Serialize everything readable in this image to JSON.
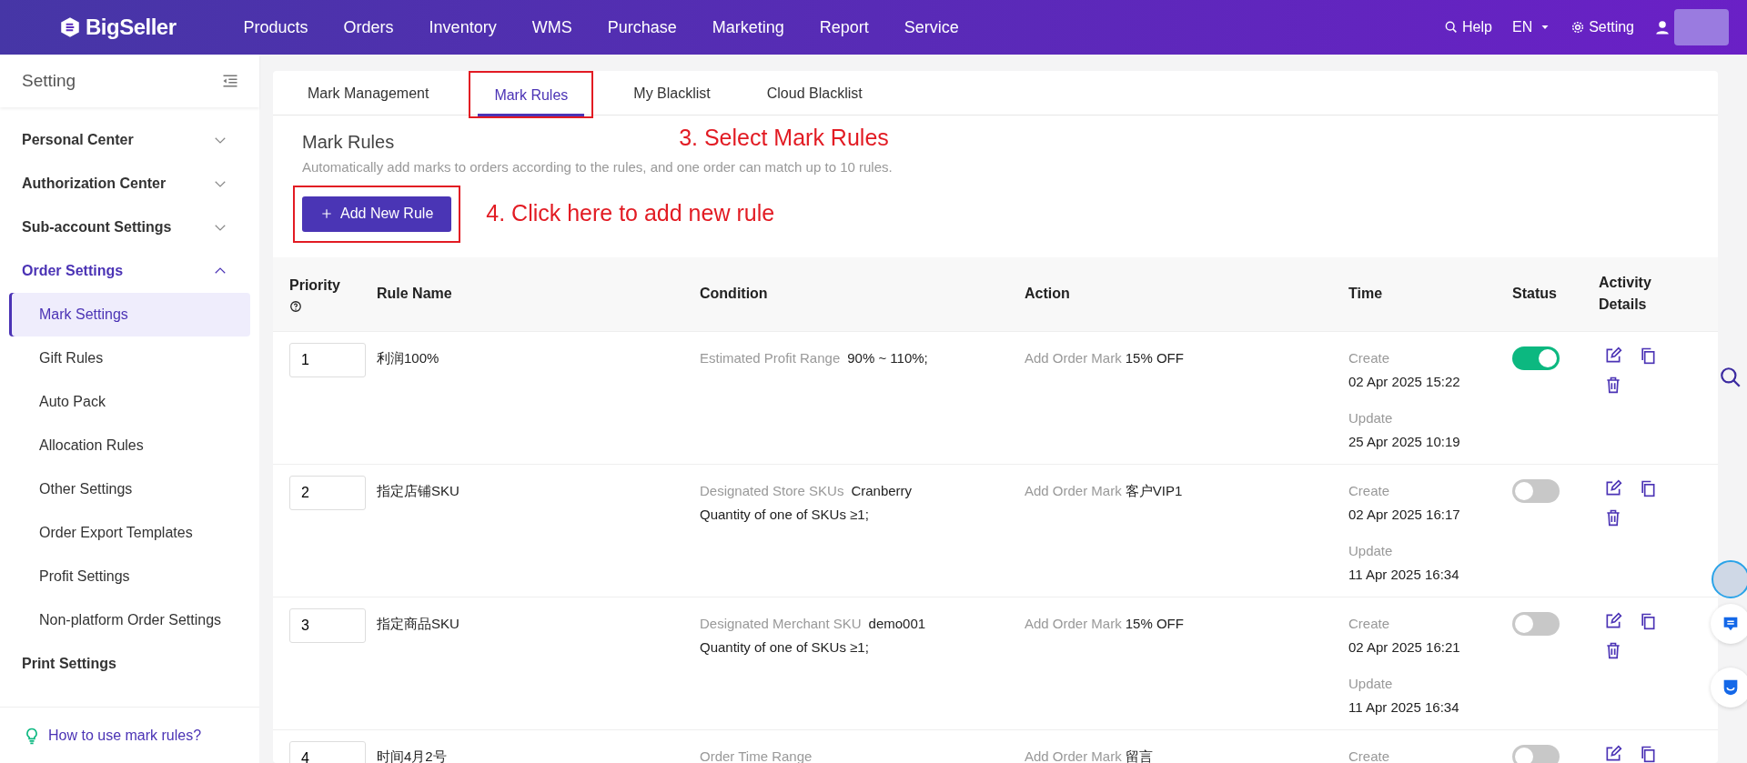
{
  "nav": {
    "logo": "BigSeller",
    "menu": [
      {
        "label": "Products"
      },
      {
        "label": "Orders"
      },
      {
        "label": "Inventory"
      },
      {
        "label": "WMS"
      },
      {
        "label": "Purchase"
      },
      {
        "label": "Marketing"
      },
      {
        "label": "Report"
      },
      {
        "label": "Service"
      }
    ],
    "help": "Help",
    "language": "EN",
    "setting": "Setting"
  },
  "sidebar": {
    "title": "Setting",
    "groups": [
      {
        "label": "Personal Center",
        "expanded": false
      },
      {
        "label": "Authorization Center",
        "expanded": false
      },
      {
        "label": "Sub-account Settings",
        "expanded": false
      },
      {
        "label": "Order Settings",
        "expanded": true,
        "children": [
          {
            "label": "Mark Settings",
            "selected": true
          },
          {
            "label": "Gift Rules",
            "selected": false
          },
          {
            "label": "Auto Pack",
            "selected": false
          },
          {
            "label": "Allocation Rules",
            "selected": false
          },
          {
            "label": "Other Settings",
            "selected": false
          },
          {
            "label": "Order Export Templates",
            "selected": false
          },
          {
            "label": "Profit Settings",
            "selected": false
          },
          {
            "label": "Non-platform Order Settings",
            "selected": false
          }
        ]
      },
      {
        "label": "Print Settings"
      }
    ],
    "help_link": "How to use mark rules?"
  },
  "tabs": [
    {
      "label": "Mark Management",
      "selected": false,
      "highlighted": false
    },
    {
      "label": "Mark Rules",
      "selected": true,
      "highlighted": true
    },
    {
      "label": "My Blacklist",
      "selected": false,
      "highlighted": false
    },
    {
      "label": "Cloud Blacklist",
      "selected": false,
      "highlighted": false
    }
  ],
  "annotations": [
    "3. Select Mark Rules",
    "4. Click here to add new rule"
  ],
  "page": {
    "title": "Mark Rules",
    "description": "Automatically add marks to orders according to the rules, and one order can match up to 10 rules.",
    "add_button": "Add New Rule"
  },
  "table": {
    "columns": [
      "Priority",
      "Rule Name",
      "Condition",
      "Action",
      "Time",
      "Status",
      "Activity Details"
    ],
    "rows": [
      {
        "priority": "1",
        "name": "利润100%",
        "condition": [
          {
            "label": "Estimated Profit Range",
            "value": "90% ~ 110%;"
          }
        ],
        "action_label": "Add Order Mark",
        "action_value": "15% OFF",
        "create_label": "Create",
        "create_time": "02 Apr 2025 15:22",
        "update_label": "Update",
        "update_time": "25 Apr 2025 10:19",
        "on": true
      },
      {
        "priority": "2",
        "name": "指定店铺SKU",
        "condition": [
          {
            "label": "Designated Store SKUs",
            "value": "Cranberry"
          },
          {
            "value": "Quantity of one of SKUs ≥1;"
          }
        ],
        "action_label": "Add Order Mark",
        "action_value": "客户VIP1",
        "create_label": "Create",
        "create_time": "02 Apr 2025 16:17",
        "update_label": "Update",
        "update_time": "11 Apr 2025 16:34",
        "on": false
      },
      {
        "priority": "3",
        "name": "指定商品SKU",
        "condition": [
          {
            "label": "Designated Merchant SKU",
            "value": "demo001"
          },
          {
            "value": "Quantity of one of SKUs ≥1;"
          }
        ],
        "action_label": "Add Order Mark",
        "action_value": "15% OFF",
        "create_label": "Create",
        "create_time": "02 Apr 2025 16:21",
        "update_label": "Update",
        "update_time": "11 Apr 2025 16:34",
        "on": false
      },
      {
        "priority": "4",
        "name": "时间4月2号",
        "condition": [
          {
            "label": "Order Time Range"
          }
        ],
        "action_label": "Add Order Mark",
        "action_value": "留言",
        "create_label": "Create",
        "on": false
      }
    ]
  }
}
